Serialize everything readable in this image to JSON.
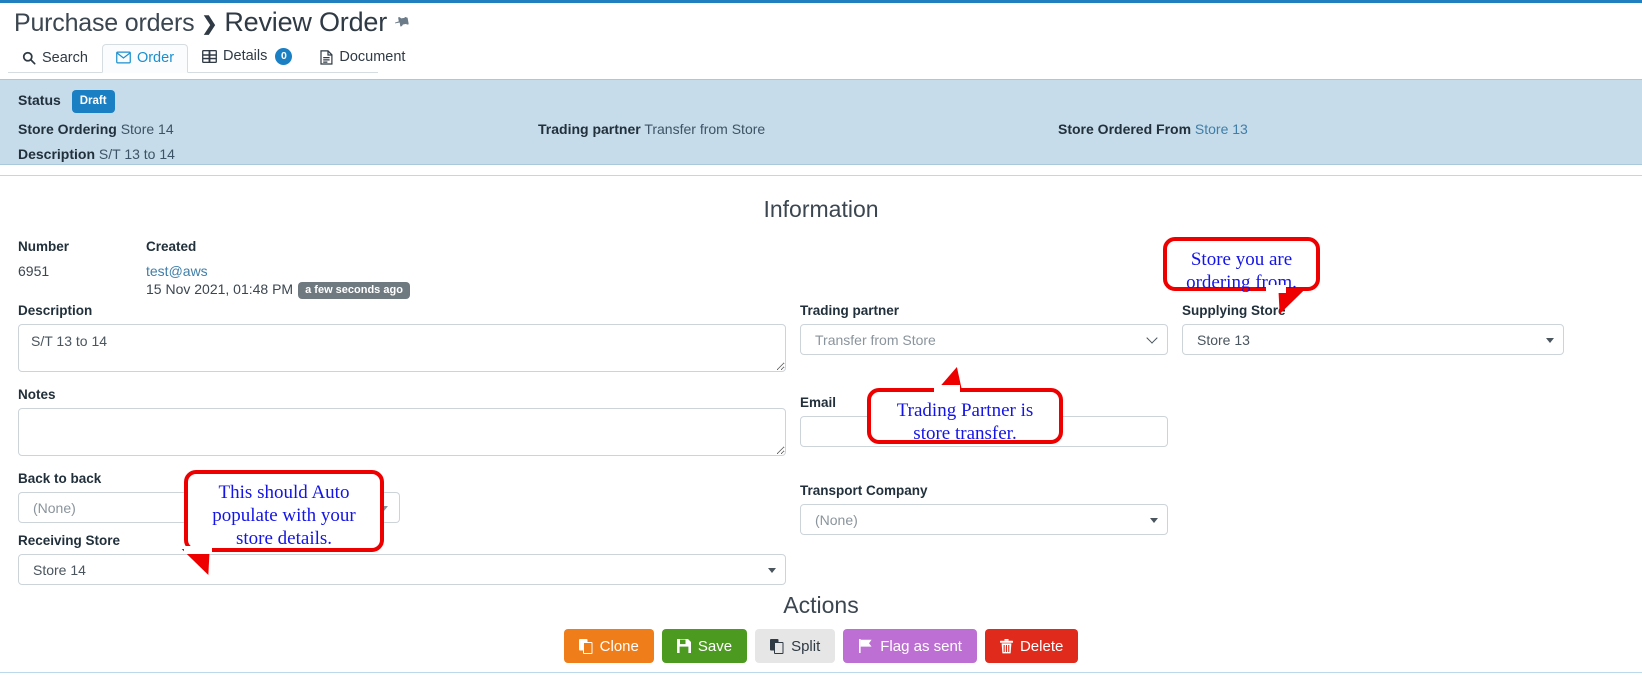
{
  "breadcrumb": {
    "parent": "Purchase orders",
    "separator": "❯",
    "current": "Review Order",
    "pin_icon": "pin-icon"
  },
  "tabs": [
    {
      "label": "Search",
      "icon": "search-icon",
      "active": false,
      "badge": null
    },
    {
      "label": "Order",
      "icon": "envelope-icon",
      "active": true,
      "badge": null
    },
    {
      "label": "Details",
      "icon": "table-icon",
      "active": false,
      "badge": "0"
    },
    {
      "label": "Document",
      "icon": "file-icon",
      "active": false,
      "badge": null
    }
  ],
  "status_panel": {
    "status_label": "Status",
    "status_value": "Draft",
    "store_ordering_label": "Store Ordering",
    "store_ordering_value": "Store 14",
    "trading_partner_label": "Trading partner",
    "trading_partner_value": "Transfer from Store",
    "store_ordered_from_label": "Store Ordered From",
    "store_ordered_from_value": "Store 13",
    "description_label": "Description",
    "description_value": "S/T 13 to 14"
  },
  "information": {
    "title": "Information",
    "number_label": "Number",
    "number_value": "6951",
    "created_label": "Created",
    "created_user": "test@aws",
    "created_datetime": "15 Nov 2021, 01:48 PM",
    "created_relative": "a few seconds ago",
    "description_label": "Description",
    "description_value": "S/T 13 to 14",
    "notes_label": "Notes",
    "notes_value": "",
    "back_to_back_label": "Back to back",
    "back_to_back_value": "(None)",
    "receiving_store_label": "Receiving Store",
    "receiving_store_value": "Store 14",
    "trading_partner_label": "Trading partner",
    "trading_partner_value": "Transfer from Store",
    "email_label": "Email",
    "email_value": "",
    "transport_company_label": "Transport Company",
    "transport_company_value": "(None)",
    "supplying_store_label": "Supplying Store",
    "supplying_store_value": "Store 13"
  },
  "actions": {
    "title": "Actions",
    "buttons": [
      {
        "label": "Clone",
        "icon": "clone-icon",
        "color": "#ef7d1a"
      },
      {
        "label": "Save",
        "icon": "save-icon",
        "color": "#4c9a20"
      },
      {
        "label": "Split",
        "icon": "split-icon",
        "color": "#e6e6e6"
      },
      {
        "label": "Flag as sent",
        "icon": "flag-icon",
        "color": "#bd6fd4"
      },
      {
        "label": "Delete",
        "icon": "trash-icon",
        "color": "#e02a1c"
      }
    ]
  },
  "annotations": [
    {
      "id": "store-ordering-from",
      "text": "Store you are ordering from."
    },
    {
      "id": "trading-partner",
      "text": "Trading Partner is store transfer."
    },
    {
      "id": "auto-populate",
      "text": "This should Auto populate with your store details."
    }
  ],
  "colors": {
    "accent": "#1b7fc4",
    "status_panel_bg": "#c7dcea",
    "annotation_border": "#ee0000",
    "annotation_text": "#1414e6"
  }
}
